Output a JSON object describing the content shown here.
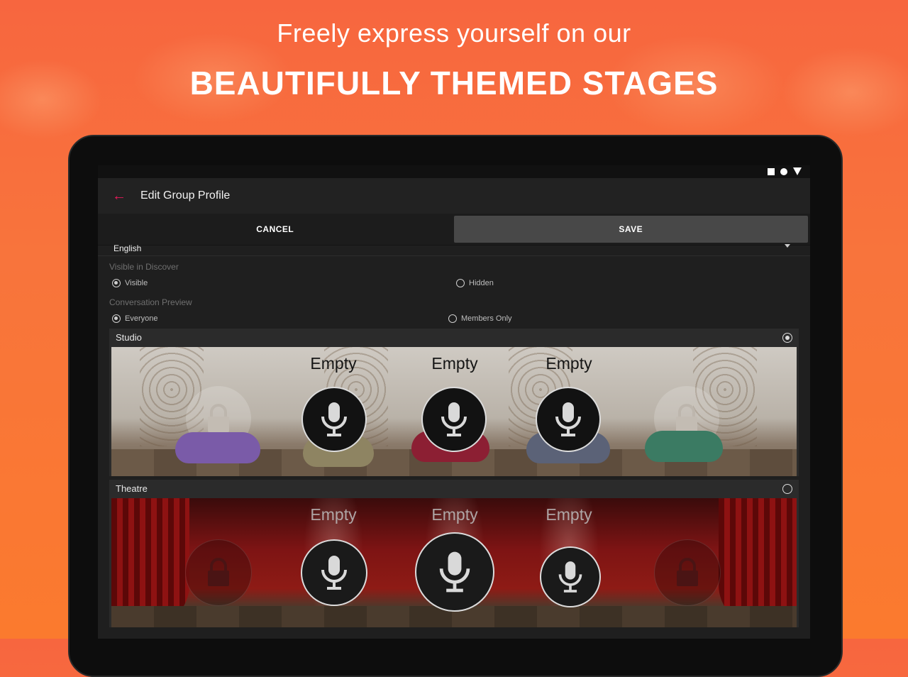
{
  "hero": {
    "line1": "Freely express yourself on our",
    "line2": "BEAUTIFULLY THEMED STAGES"
  },
  "appbar": {
    "title": "Edit Group Profile"
  },
  "actions": {
    "cancel": "CANCEL",
    "save": "SAVE"
  },
  "language": {
    "value": "English"
  },
  "visible_in_discover": {
    "label": "Visible in Discover",
    "options": [
      "Visible",
      "Hidden"
    ],
    "selected": "Visible"
  },
  "conversation_preview": {
    "label": "Conversation Preview",
    "options": [
      "Everyone",
      "Members Only"
    ],
    "selected": "Everyone"
  },
  "themes": [
    {
      "name": "Studio",
      "selected": true,
      "slots": [
        "Empty",
        "Empty",
        "Empty"
      ]
    },
    {
      "name": "Theatre",
      "selected": false,
      "slots": [
        "Empty",
        "Empty",
        "Empty"
      ]
    }
  ],
  "colors": {
    "accent": "#e6195a",
    "bg_top": "#f7663f",
    "bg_bottom": "#fb7a2e"
  },
  "icons": [
    "back-arrow-icon",
    "microphone-icon",
    "lock-icon",
    "dropdown-caret-icon"
  ]
}
